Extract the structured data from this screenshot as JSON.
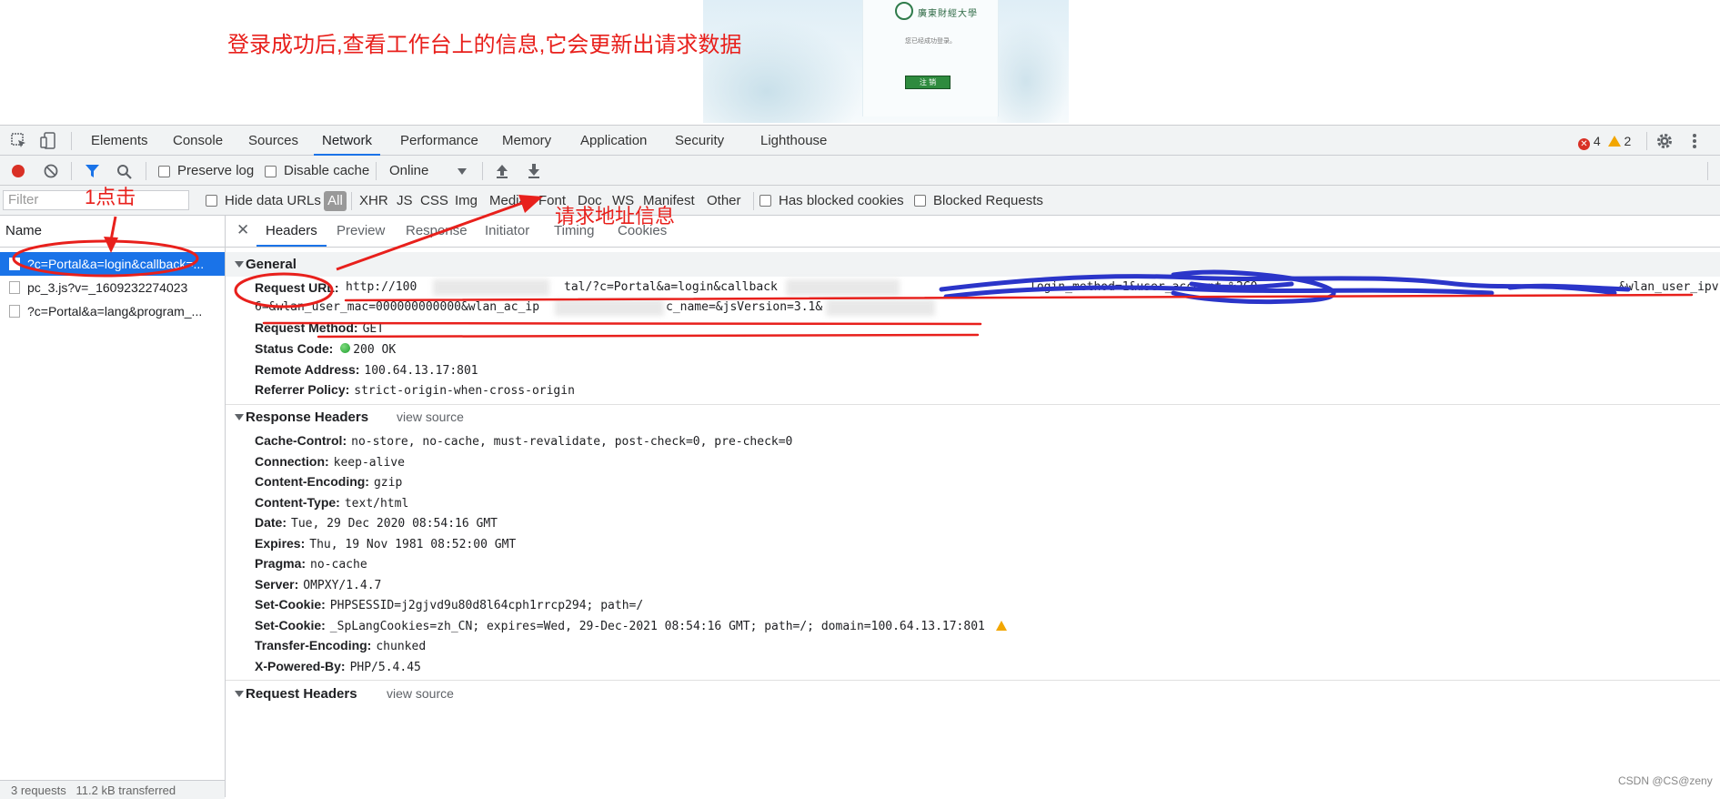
{
  "caption": "登录成功后,查看工作台上的信息,它会更新出请求数据",
  "embedded_page": {
    "logo_text": "廣東財經大學",
    "message": "您已经成功登录。",
    "logout_button": "注 销"
  },
  "tabs": [
    {
      "label": "Elements"
    },
    {
      "label": "Console"
    },
    {
      "label": "Sources"
    },
    {
      "label": "Network"
    },
    {
      "label": "Performance"
    },
    {
      "label": "Memory"
    },
    {
      "label": "Application"
    },
    {
      "label": "Security"
    },
    {
      "label": "Lighthouse"
    }
  ],
  "badges": {
    "errors": "4",
    "warnings": "2"
  },
  "toolbar": {
    "preserve_log": "Preserve log",
    "disable_cache": "Disable cache",
    "throttling": "Online"
  },
  "filterbar": {
    "filter_placeholder": "Filter",
    "hide_data_urls": "Hide data URLs",
    "all": "All",
    "types": [
      "XHR",
      "JS",
      "CSS",
      "Img",
      "Media",
      "Font",
      "Doc",
      "WS",
      "Manifest",
      "Other"
    ],
    "has_blocked_cookies": "Has blocked cookies",
    "blocked_requests": "Blocked Requests"
  },
  "requests": {
    "header": "Name",
    "items": [
      {
        "name": "?c=Portal&a=login&callback=..."
      },
      {
        "name": "pc_3.js?v=_1609232274023"
      },
      {
        "name": "?c=Portal&a=lang&program_..."
      }
    ],
    "status": "3 requests   11.2 kB transferred"
  },
  "detail_tabs": [
    "Headers",
    "Preview",
    "Response",
    "Initiator",
    "Timing",
    "Cookies"
  ],
  "general": {
    "title": "General",
    "request_url_label": "Request URL:",
    "request_url_line1_a": "http://100",
    "request_url_line1_b": "tal/?c=Portal&a=login&callback",
    "request_url_line1_c": "login_method=1&user_account=%2C0",
    "request_url_line1_d": "&wlan_user_ipv",
    "request_url_line2_a": "6=&wlan_user_mac=000000000000&wlan_ac_ip",
    "request_url_line2_b": "c_name=&jsVersion=3.1&",
    "request_method_label": "Request Method:",
    "request_method": "GET",
    "status_code_label": "Status Code:",
    "status_code": "200 OK",
    "remote_address_label": "Remote Address:",
    "remote_address": "100.64.13.17:801",
    "referrer_policy_label": "Referrer Policy:",
    "referrer_policy": "strict-origin-when-cross-origin"
  },
  "response_headers": {
    "title": "Response Headers",
    "view_source": "view source",
    "items": [
      {
        "k": "Cache-Control:",
        "v": "no-store, no-cache, must-revalidate, post-check=0, pre-check=0"
      },
      {
        "k": "Connection:",
        "v": "keep-alive"
      },
      {
        "k": "Content-Encoding:",
        "v": "gzip"
      },
      {
        "k": "Content-Type:",
        "v": "text/html"
      },
      {
        "k": "Date:",
        "v": "Tue, 29 Dec 2020 08:54:16 GMT"
      },
      {
        "k": "Expires:",
        "v": "Thu, 19 Nov 1981 08:52:00 GMT"
      },
      {
        "k": "Pragma:",
        "v": "no-cache"
      },
      {
        "k": "Server:",
        "v": "OMPXY/1.4.7"
      },
      {
        "k": "Set-Cookie:",
        "v": "PHPSESSID=j2gjvd9u80d8l64cph1rrcp294; path=/"
      },
      {
        "k": "Set-Cookie:",
        "v": "_SpLangCookies=zh_CN; expires=Wed, 29-Dec-2021 08:54:16 GMT; path=/; domain=100.64.13.17:801"
      },
      {
        "k": "Transfer-Encoding:",
        "v": "chunked"
      },
      {
        "k": "X-Powered-By:",
        "v": "PHP/5.4.45"
      }
    ]
  },
  "request_headers": {
    "title": "Request Headers",
    "view_source": "view source"
  },
  "annotations": {
    "click": "1点击",
    "request_info": "请求地址信息"
  },
  "watermark": "CSDN @CS@zeny",
  "colors": {
    "accent": "#1a73e8",
    "annotation": "#e8201c",
    "scribble": "#2b35c9"
  }
}
